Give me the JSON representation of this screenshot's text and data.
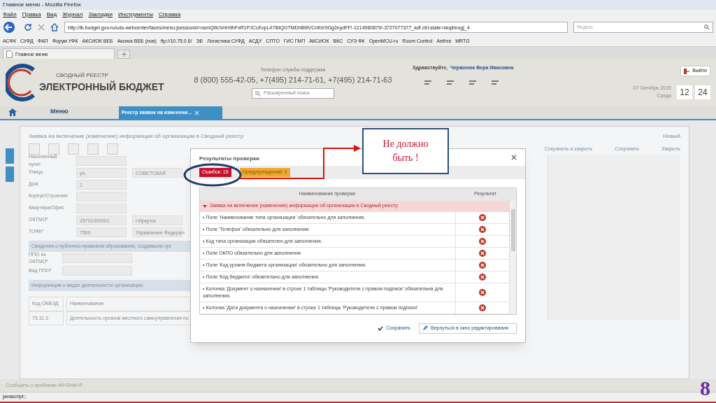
{
  "browser": {
    "title": "Главное меню - Mozilla Firefox",
    "menu": [
      "Файл",
      "Правка",
      "Вид",
      "Журнал",
      "Закладки",
      "Инструменты",
      "Справка"
    ],
    "url": "http://lk.budget.gov.ru/udu-webcenter/faces/menu;jsessionid=nsmQWJvhH9hFxR1PJCcKvpL47l6IQGTMDhBl9VCnthX9Gg2nydFF!-1214960879!-3727077377_adf.ctrl-state=xkqiimogj_4",
    "search_placeholder": "Яндекс",
    "bookmarks": [
      "АСФК",
      "СУФД",
      "ФАП",
      "Форум УФК",
      "АКСИОК ВЕБ",
      "Аксиок ВЕБ (нов)",
      "ftp://10.75.0.6/",
      "ЭБ",
      "Логистика СУФД",
      "АСДУ",
      "СПТО",
      "ГИС ГМП",
      "АКСИОК",
      "ВКС",
      "СУЭ ФК",
      "OpenMCU-ru",
      "Room Control",
      "Aethra",
      "MRTG"
    ],
    "tab": "Главное меню"
  },
  "header": {
    "registry_label": "СВОДНЫЙ РЕЕСТР",
    "app_name": "ЭЛЕКТРОННЫЙ БЮДЖЕТ",
    "support_label": "Телефон службы поддержки",
    "phones": "8 (800) 555-42-05, +7(495) 214-71-61, +7(495) 214-71-63",
    "search_placeholder": "Расширенный поиск",
    "greeting": "Здравствуйте,",
    "user": "Червонюк Вера Ивановна",
    "logout": "Выйти",
    "date": "07 Октябрь 2015",
    "weekday": "Среда",
    "hours": "12",
    "minutes": "24"
  },
  "nav": {
    "menu": "Меню",
    "tabs": [
      {
        "label": "Реестр заявок на изменени...",
        "selected": true
      }
    ]
  },
  "form": {
    "title": "Заявка на включение (изменение) информации об организации в Сводный реестр",
    "new": "Новый",
    "actions": [
      "Сохранить и закрыть",
      "Сохранить",
      "Закрыть"
    ],
    "fields": [
      {
        "label": "Населенный пункт"
      },
      {
        "label": "Улица",
        "values": [
          "ул.",
          "СОВЕТСКАЯ"
        ]
      },
      {
        "label": "Дом",
        "values": [
          "1"
        ]
      },
      {
        "label": "Корпус/Строение"
      },
      {
        "label": "Квартира/Офис"
      },
      {
        "label": "ОКТМО*",
        "values": [
          "25701000001",
          "г.Иркутск"
        ]
      },
      {
        "label": "ТОФК*",
        "values": [
          "7500",
          "Управление Федерал"
        ]
      }
    ],
    "sections": [
      {
        "title": "Сведения о публично-правовом образовании, создавшем орг",
        "expanded": true,
        "fields": [
          "ППО из ОКТМО*",
          "Вид ППО*"
        ]
      },
      {
        "title": "Информация о видах деятельности организации",
        "expanded": true
      }
    ],
    "activity_columns": [
      "Код ОКВЭД",
      "Наименование"
    ],
    "activity_row": [
      "75.11.3",
      "Деятельность органов местного самоуправления по"
    ]
  },
  "dialog": {
    "title": "Результаты проверки",
    "badges": [
      {
        "label": "Ошибок: 15",
        "kind": "error"
      },
      {
        "label": "Предупреждений: 3",
        "kind": "warning"
      }
    ],
    "columns": [
      "Наименование проверки",
      "Результат"
    ],
    "group": {
      "label": "Заявка на включение (изменение) информации об организации в Сводный реестр",
      "expanded": true
    },
    "rows": [
      {
        "text": "• Поле 'Наименование типа организации' обязательно для заполнения.",
        "passed": false
      },
      {
        "text": "• Поле 'Телефон' обязательно для заполнения.",
        "passed": false
      },
      {
        "text": "• Код типа организации обязателен для заполнения.",
        "passed": false
      },
      {
        "text": "• Поле ОКПО обязательно для заполнения.",
        "passed": false
      },
      {
        "text": "• Поле 'Код уровня бюджета организации' обязательно для заполнения.",
        "passed": false
      },
      {
        "text": "• Поле 'Код бюджета' обязательно для заполнения.",
        "passed": false
      },
      {
        "text": "• Колонка 'Документ о назначении' в строке 1 таблицы 'Руководители с правом подписи' обязательна для заполнения.",
        "passed": false
      },
      {
        "text": "• Колонка 'Дата документа о назначении' в строке 1 таблицы 'Руководители с правом подписи'",
        "passed": false
      }
    ],
    "buttons": [
      {
        "label": "Сохранить",
        "kind": "save"
      },
      {
        "label": "Вернуться в окно редактирования",
        "kind": "back"
      }
    ]
  },
  "annotation": "Не должно быть !",
  "footer": "Сообщить о проблеме Alt+Shift+P",
  "status": "javascript:;",
  "slide_number": "8"
}
